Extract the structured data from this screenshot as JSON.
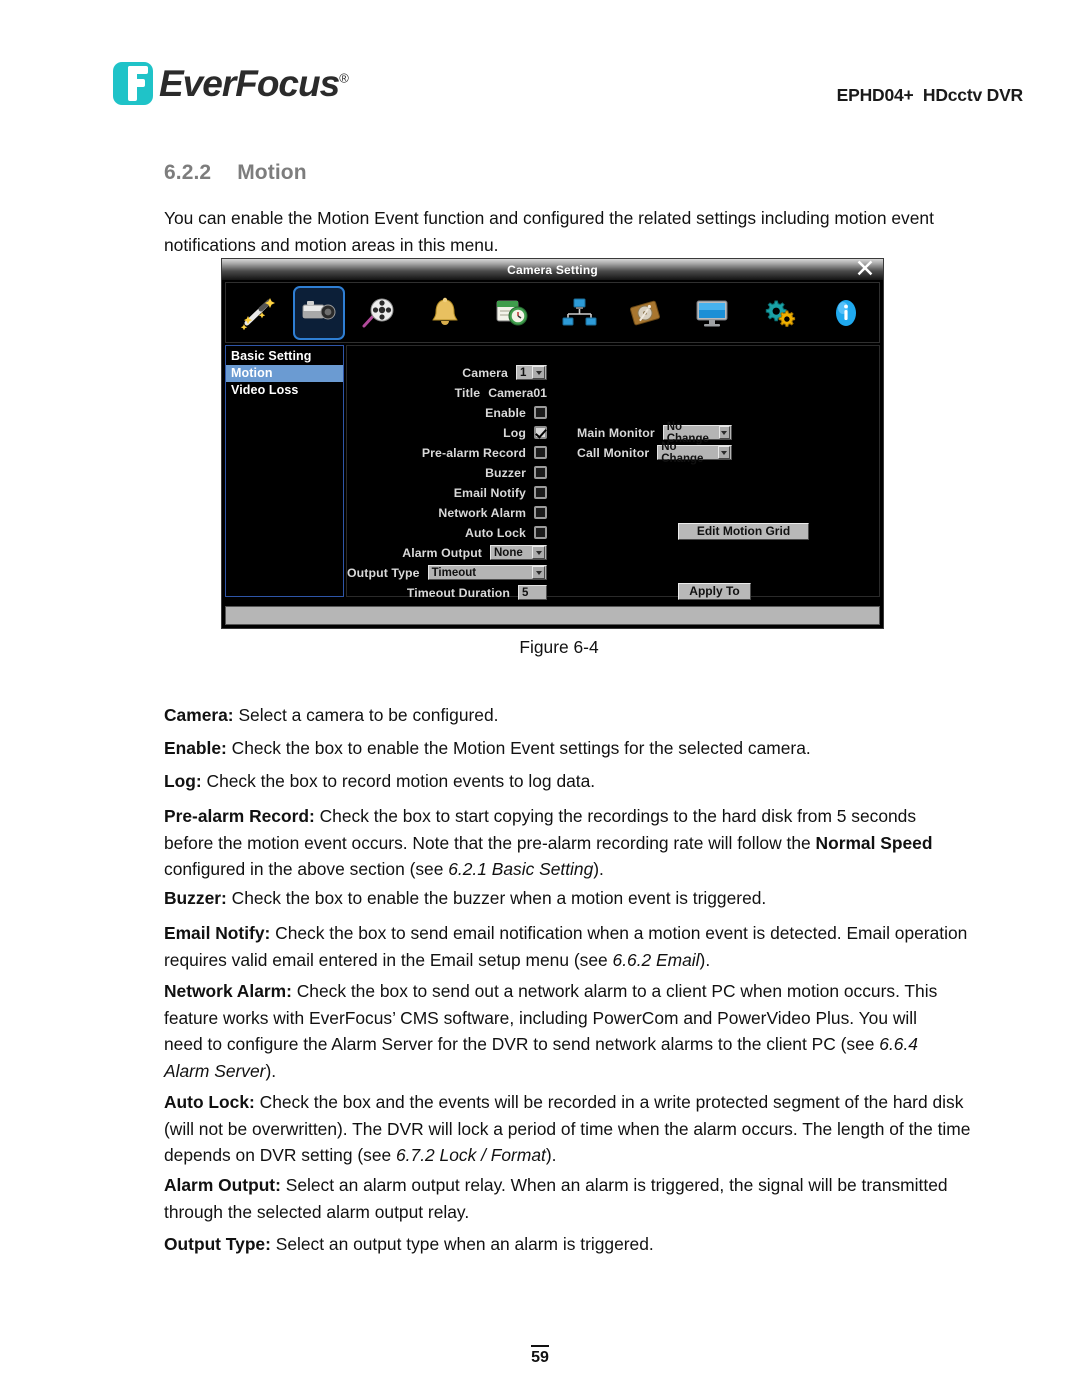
{
  "header": {
    "logo_text": "EverFocus",
    "logo_reg": "®",
    "model": "EPHD04+  HDcctv DVR"
  },
  "section": {
    "number": "6.2.2",
    "title": "Motion",
    "intro": "You can enable the Motion Event function and configured the related settings including motion event notifications and motion areas in this menu."
  },
  "figure": {
    "caption": "Figure 6-4",
    "dialog": {
      "title": "Camera Setting",
      "close_icon": "✕",
      "toolbar_icons": [
        "magic-wand-icon",
        "camera-icon",
        "film-reel-icon",
        "bell-icon",
        "schedule-clock-icon",
        "network-icon",
        "hard-disk-icon",
        "monitor-icon",
        "gears-icon",
        "info-icon"
      ],
      "sidebar": [
        {
          "label": "Basic Setting",
          "active": false
        },
        {
          "label": "Motion",
          "active": true
        },
        {
          "label": "Video Loss",
          "active": false
        }
      ],
      "fields": {
        "camera_label": "Camera",
        "camera_value": "1",
        "title_label": "Title",
        "title_value": "Camera01",
        "enable_label": "Enable",
        "enable_checked": false,
        "log_label": "Log",
        "log_checked": true,
        "prealarm_label": "Pre-alarm Record",
        "prealarm_checked": false,
        "buzzer_label": "Buzzer",
        "buzzer_checked": false,
        "email_label": "Email Notify",
        "email_checked": false,
        "network_label": "Network Alarm",
        "network_checked": false,
        "autolock_label": "Auto Lock",
        "autolock_checked": false,
        "alarm_output_label": "Alarm Output",
        "alarm_output_value": "None",
        "output_type_label": "Output Type",
        "output_type_value": "Timeout",
        "timeout_label": "Timeout Duration",
        "timeout_value": "5",
        "main_monitor_label": "Main Monitor",
        "main_monitor_value": "No Change",
        "call_monitor_label": "Call Monitor",
        "call_monitor_value": "No Change"
      },
      "buttons": {
        "edit_motion_grid": "Edit Motion Grid",
        "apply_to": "Apply To"
      }
    }
  },
  "descriptions": [
    {
      "term": "Camera:",
      "body": " Select a camera to be configured."
    },
    {
      "term": "Enable:",
      "body": " Check the box to enable the Motion Event settings for the selected camera."
    },
    {
      "term": "Log:",
      "body": " Check the box to record motion events to log data."
    },
    {
      "term": "Pre-alarm Record:",
      "body": " Check the box to start copying the recordings to the hard disk from 5 seconds before the motion event occurs. Note that the pre-alarm recording rate will follow the "
    },
    {
      "term": "Buzzer:",
      "body": " Check the box to enable the buzzer when a motion event is triggered."
    },
    {
      "term": "Email Notify:",
      "body": " Check the box to send email notification when a motion event is detected. Email operation requires valid email entered in the Email setup menu (see "
    },
    {
      "term": "Network Alarm:",
      "body": " Check the box to send out a network alarm to a client PC when motion occurs. This feature works with EverFocus’ CMS software, including PowerCom and PowerVideo Plus. You will need to configure the Alarm Server for the DVR to send network alarms to the client PC (see "
    },
    {
      "term": "Auto Lock:",
      "body": " Check the box and the events will be recorded in a write protected segment of the hard disk (will not be overwritten). The DVR will lock a period of time when the alarm occurs. The length of the time depends on DVR setting (see "
    },
    {
      "term": "Alarm Output:",
      "body": " Select an alarm output relay. When an alarm is triggered, the signal will be transmitted through the selected alarm output relay."
    },
    {
      "term": "Output Type:",
      "body": " Select an output type when an alarm is triggered."
    }
  ],
  "inline": {
    "normal_speed": "Normal Speed",
    "prealarm_tail_1": " configured in the above section (see ",
    "ref_621": "6.2.1 Basic Setting",
    "ref_662": "6.6.2 Email",
    "ref_664": "6.6.4 Alarm Server",
    "ref_672": "6.7.2 Lock / Format",
    "close_paren": ")."
  },
  "footer": {
    "page_number": "59"
  }
}
